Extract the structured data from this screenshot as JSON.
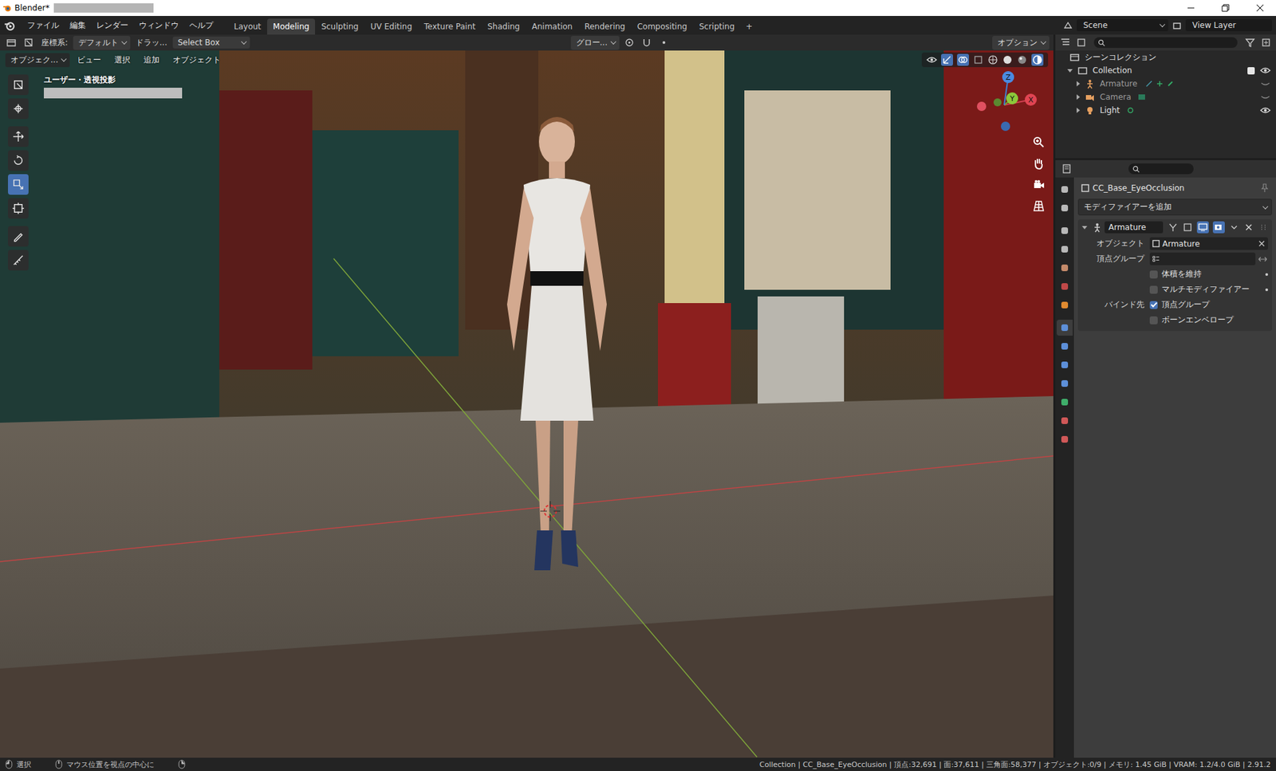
{
  "window": {
    "title": "Blender*"
  },
  "menu": [
    "ファイル",
    "編集",
    "レンダー",
    "ウィンドウ",
    "ヘルプ"
  ],
  "workspaces": [
    {
      "label": "Layout",
      "selected": false
    },
    {
      "label": "Modeling",
      "selected": true
    },
    {
      "label": "Sculpting",
      "selected": false
    },
    {
      "label": "UV Editing",
      "selected": false
    },
    {
      "label": "Texture Paint",
      "selected": false
    },
    {
      "label": "Shading",
      "selected": false
    },
    {
      "label": "Animation",
      "selected": false
    },
    {
      "label": "Rendering",
      "selected": false
    },
    {
      "label": "Compositing",
      "selected": false
    },
    {
      "label": "Scripting",
      "selected": false
    }
  ],
  "add_workspace": "+",
  "scene": "Scene",
  "view_layer": "View Layer",
  "tool_header": {
    "orientation_label": "座標系:",
    "orientation": "デフォルト",
    "drag": "ドラッ...",
    "select_mode": "Select Box",
    "transform": "グロー...",
    "options": "オプション"
  },
  "viewport": {
    "mode": "オブジェク...",
    "menus": [
      "ビュー",
      "選択",
      "追加",
      "オブジェクト"
    ],
    "overlay_text": "ユーザー・透視投影",
    "axes": [
      "X",
      "Y",
      "Z"
    ]
  },
  "tools": [
    {
      "selected": false
    },
    {
      "selected": false
    },
    {
      "selected": false
    },
    {
      "selected": false
    },
    {
      "selected": true
    },
    {
      "selected": false
    },
    {
      "selected": false
    },
    {
      "selected": false
    }
  ],
  "outliner": {
    "items": [
      {
        "label": "シーンコレクション",
        "kind": "scene",
        "expanded": true,
        "visible": true,
        "checked": false
      },
      {
        "label": "Collection",
        "kind": "collection",
        "expanded": true,
        "visible": true,
        "checked": true
      },
      {
        "label": "Armature",
        "kind": "armature",
        "expanded": false,
        "visible": false,
        "checked": false
      },
      {
        "label": "Camera",
        "kind": "camera",
        "expanded": false,
        "visible": false,
        "checked": false
      },
      {
        "label": "Light",
        "kind": "light",
        "expanded": false,
        "visible": true,
        "checked": false
      }
    ]
  },
  "property_tabs": [
    {
      "selected": false,
      "color": "#b8b8b8"
    },
    {
      "selected": false,
      "color": "#b8b8b8"
    },
    {
      "selected": false,
      "color": "#b8b8b8"
    },
    {
      "selected": false,
      "color": "#b8b8b8"
    },
    {
      "selected": false,
      "color": "#c48a6a"
    },
    {
      "selected": false,
      "color": "#c04848"
    },
    {
      "selected": false,
      "color": "#e08a30"
    },
    {
      "selected": true,
      "color": "#5d8fd8"
    },
    {
      "selected": false,
      "color": "#5d8fd8"
    },
    {
      "selected": false,
      "color": "#5d8fd8"
    },
    {
      "selected": false,
      "color": "#5d8fd8"
    },
    {
      "selected": false,
      "color": "#3fae6a"
    },
    {
      "selected": false,
      "color": "#d05858"
    },
    {
      "selected": false,
      "color": "#d05858"
    }
  ],
  "properties": {
    "object": "CC_Base_EyeOcclusion",
    "add_modifier": "モディファイアーを追加",
    "modifier": {
      "name": "Armature",
      "expanded": true,
      "fields": [
        {
          "label": "オブジェクト",
          "value": "Armature"
        },
        {
          "label": "頂点グループ",
          "value": ""
        }
      ],
      "options": [
        {
          "label": "体積を維持",
          "checked": false
        },
        {
          "label": "マルチモディファイアー",
          "checked": false
        }
      ],
      "bind_label": "バインド先",
      "bind": [
        {
          "label": "頂点グループ",
          "checked": true
        },
        {
          "label": "ボーンエンベロープ",
          "checked": false
        }
      ]
    }
  },
  "status_bar": {
    "left": [
      "選択",
      "マウス位置を視点の中心に"
    ],
    "stats": "Collection | CC_Base_EyeOcclusion | 頂点:32,691 | 面:37,611 | 三角面:58,377 | オブジェクト:0/9 | メモリ: 1.45 GiB | VRAM: 1.2/4.0 GiB | 2.91.2"
  }
}
